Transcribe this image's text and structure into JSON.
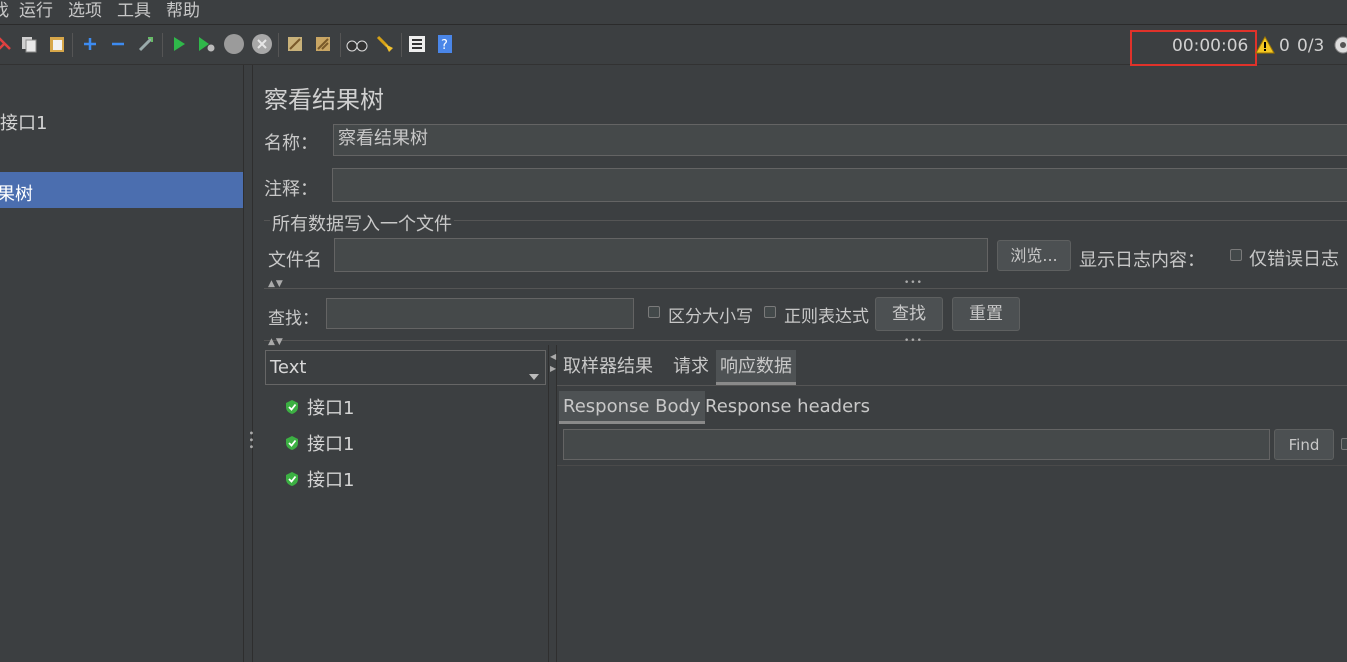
{
  "menu": [
    "找",
    "运行",
    "选项",
    "工具",
    "帮助"
  ],
  "toolbar": {
    "timer": "00:00:06",
    "warnings": "0",
    "threads": "0/3"
  },
  "tree": {
    "item1": "接口1",
    "item2": "果树"
  },
  "panel": {
    "title": "察看结果树",
    "name_label": "名称：",
    "name_value": "察看结果树",
    "comment_label": "注释：",
    "comment_value": "",
    "file_section_title": "所有数据写入一个文件",
    "filename_label": "文件名",
    "filename_value": "",
    "browse_label": "浏览...",
    "show_log_label": "显示日志内容：",
    "errors_only_label": "仅错误日志",
    "search_label": "查找：",
    "search_value": "",
    "case_sensitive_label": "区分大小写",
    "regex_label": "正则表达式",
    "find_button": "查找",
    "reset_button": "重置"
  },
  "results": {
    "renderer": "Text",
    "items": [
      "接口1",
      "接口1",
      "接口1"
    ],
    "tabs": [
      "取样器结果",
      "请求",
      "响应数据"
    ],
    "selected_tab": "响应数据",
    "subtabs": [
      "Response Body",
      "Response headers"
    ],
    "selected_subtab": "Response Body",
    "find_value": "",
    "find_button": "Find"
  },
  "colors": {
    "background": "#3c3f41",
    "selection": "#4b6eaf",
    "timer_highlight": "#e0322a",
    "success_icon": "#3cb043"
  }
}
